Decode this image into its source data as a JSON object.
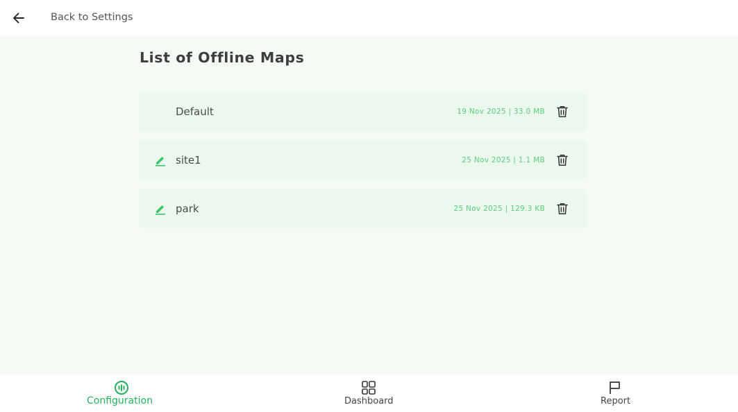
{
  "header": {
    "back_label": "Back to Settings",
    "back_icon": "arrow-left-icon"
  },
  "main": {
    "title": "List of Offline Maps",
    "maps": [
      {
        "name": "Default",
        "meta": "19 Nov 2025 | 33.0 MB",
        "editable": false
      },
      {
        "name": "site1",
        "meta": "25 Nov 2025 | 1.1 MB",
        "editable": true
      },
      {
        "name": "park",
        "meta": "25 Nov 2025 | 129.3 KB",
        "editable": true
      }
    ]
  },
  "bottom_nav": {
    "items": [
      {
        "label": "Configuration",
        "icon": "configuration-icon",
        "active": true
      },
      {
        "label": "Dashboard",
        "icon": "dashboard-icon",
        "active": false
      },
      {
        "label": "Report",
        "icon": "flag-icon",
        "active": false
      }
    ]
  },
  "colors": {
    "accent": "#22b35a",
    "meta_text": "#5ecb7f",
    "content_bg": "#f3fbf4",
    "item_bg": "#ebf8ee"
  }
}
